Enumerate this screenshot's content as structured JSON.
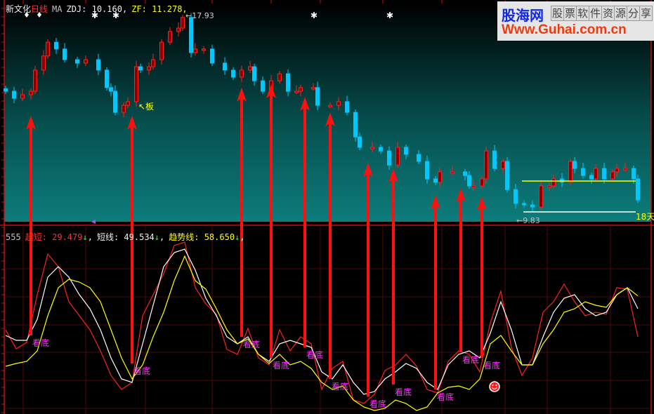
{
  "header": {
    "stock_name": "新文化",
    "period": "日线",
    "ma_label": "MA",
    "zdj": "ZDJ: 10.160,",
    "zf": "ZF: 11.278,"
  },
  "indicator_header": {
    "name": "555",
    "chaoduan": "超短: 29.479",
    "duanxian": "短线: 49.534",
    "qushixian": "趋势线: 58.650",
    "down_arrow": "↓",
    "comma": ","
  },
  "logo": {
    "brand": "股海网",
    "slogan": [
      "股",
      "票",
      "软",
      "件",
      "资",
      "源",
      "分",
      "享"
    ],
    "url": "Www.Guhai.com.cn"
  },
  "annotations": {
    "high_label": "←17.93",
    "low_label": "←9.83",
    "days_label": "18天",
    "board_label": "↖板"
  },
  "colors": {
    "up": "#ff2020",
    "down": "#00c8ff",
    "chaoduan": "#ff2020",
    "duanxian": "#ffffff",
    "qushixian": "#ffff00",
    "signal": "#ff1010",
    "signal_label": "#ff30ff"
  },
  "chart_data": [
    {
      "type": "candlestick",
      "title": "新文化 日线",
      "xlabel": "bar",
      "ylabel": "price",
      "ylim": [
        9.5,
        18.5
      ],
      "high_price": 17.93,
      "low_price": 9.83,
      "range_high_line": 11.05,
      "candles": [
        {
          "b": 0,
          "c": 14.75
        },
        {
          "b": 2,
          "c": 14.46
        },
        {
          "b": 4,
          "c": 14.61
        },
        {
          "b": 6,
          "c": 14.75
        },
        {
          "b": 7,
          "c": 15.62
        },
        {
          "b": 9,
          "c": 16.2
        },
        {
          "b": 10,
          "c": 16.77
        },
        {
          "b": 12,
          "c": 16.49
        },
        {
          "b": 14,
          "c": 16.05
        },
        {
          "b": 17,
          "c": 15.91
        },
        {
          "b": 19,
          "c": 16.05
        },
        {
          "b": 22,
          "c": 15.62
        },
        {
          "b": 24,
          "c": 14.9
        },
        {
          "b": 25,
          "c": 14.75
        },
        {
          "b": 26,
          "c": 13.88
        },
        {
          "b": 28,
          "c": 14.17
        },
        {
          "b": 29,
          "c": 14.32
        },
        {
          "b": 31,
          "c": 15.76
        },
        {
          "b": 32,
          "c": 15.62
        },
        {
          "b": 34,
          "c": 15.76
        },
        {
          "b": 35,
          "c": 16.05
        },
        {
          "b": 37,
          "c": 16.77
        },
        {
          "b": 39,
          "c": 17.21
        },
        {
          "b": 41,
          "c": 17.35
        },
        {
          "b": 42,
          "c": 17.79
        },
        {
          "b": 44,
          "c": 16.34
        },
        {
          "b": 45,
          "c": 16.49
        },
        {
          "b": 47,
          "c": 16.49
        },
        {
          "b": 49,
          "c": 15.91
        },
        {
          "b": 52,
          "c": 15.62
        },
        {
          "b": 54,
          "c": 15.33
        },
        {
          "b": 56,
          "c": 15.62
        },
        {
          "b": 58,
          "c": 15.76
        },
        {
          "b": 59,
          "c": 15.18
        },
        {
          "b": 61,
          "c": 14.75
        },
        {
          "b": 63,
          "c": 15.18
        },
        {
          "b": 65,
          "c": 15.47
        },
        {
          "b": 67,
          "c": 14.75
        },
        {
          "b": 69,
          "c": 14.75
        },
        {
          "b": 70,
          "c": 14.9
        },
        {
          "b": 73,
          "c": 14.9
        },
        {
          "b": 74,
          "c": 14.17
        },
        {
          "b": 77,
          "c": 14.17
        },
        {
          "b": 79,
          "c": 14.32
        },
        {
          "b": 81,
          "c": 13.88
        },
        {
          "b": 83,
          "c": 12.87
        },
        {
          "b": 84,
          "c": 12.44
        },
        {
          "b": 87,
          "c": 12.44
        },
        {
          "b": 89,
          "c": 12.29
        },
        {
          "b": 91,
          "c": 11.71
        },
        {
          "b": 93,
          "c": 12.44
        },
        {
          "b": 95,
          "c": 12.15
        },
        {
          "b": 98,
          "c": 11.86
        },
        {
          "b": 100,
          "c": 11.14
        },
        {
          "b": 102,
          "c": 11.0
        },
        {
          "b": 103,
          "c": 11.43
        },
        {
          "b": 106,
          "c": 11.43
        },
        {
          "b": 109,
          "c": 11.28
        },
        {
          "b": 110,
          "c": 10.85
        },
        {
          "b": 111,
          "c": 10.85
        },
        {
          "b": 113,
          "c": 11.14
        },
        {
          "b": 114,
          "c": 12.29
        },
        {
          "b": 116,
          "c": 11.57
        },
        {
          "b": 118,
          "c": 11.86
        },
        {
          "b": 119,
          "c": 10.7
        },
        {
          "b": 121,
          "c": 10.13
        },
        {
          "b": 123,
          "c": 10.07
        },
        {
          "b": 125,
          "c": 9.98
        },
        {
          "b": 127,
          "c": 10.85
        },
        {
          "b": 129,
          "c": 10.85
        },
        {
          "b": 130,
          "c": 11.14
        },
        {
          "b": 132,
          "c": 11.0
        },
        {
          "b": 134,
          "c": 11.86
        },
        {
          "b": 135,
          "c": 11.57
        },
        {
          "b": 137,
          "c": 11.28
        },
        {
          "b": 139,
          "c": 11.14
        },
        {
          "b": 140,
          "c": 11.57
        },
        {
          "b": 142,
          "c": 11.14
        },
        {
          "b": 144,
          "c": 11.43
        },
        {
          "b": 145,
          "c": 11.57
        },
        {
          "b": 147,
          "c": 11.57
        },
        {
          "b": 149,
          "c": 11.14
        },
        {
          "b": 150,
          "c": 10.27
        }
      ],
      "markers": [
        {
          "b": 5,
          "shape": "diamond"
        },
        {
          "b": 8,
          "shape": "diamond"
        },
        {
          "b": 21,
          "shape": "star"
        },
        {
          "b": 26,
          "shape": "star"
        },
        {
          "b": 73,
          "shape": "star"
        },
        {
          "b": 91,
          "shape": "star"
        }
      ]
    },
    {
      "type": "line",
      "title": "555",
      "xlabel": "bar",
      "ylabel": "value",
      "bar_step": 2.5,
      "ylim": [
        -25,
        100
      ],
      "series": [
        {
          "name": "超短",
          "values": [
            34.5,
            21,
            25.5,
            59.5,
            88.5,
            79.5,
            54.5,
            44.5,
            34.5,
            19.5,
            2,
            -8,
            -3,
            44.5,
            59.5,
            74.5,
            94.5,
            97,
            64.5,
            53,
            45.5,
            20.5,
            17,
            35.5,
            14.5,
            9.5,
            34.5,
            19.5,
            29.5,
            24.5,
            -8,
            7,
            12,
            -15.5,
            -18,
            -11.5,
            5.5,
            9.5,
            17,
            8.5,
            -8,
            -10.5,
            12,
            19.5,
            17,
            4.5,
            39.5,
            62,
            22,
            2,
            14.5,
            47,
            54.5,
            67,
            54.5,
            44.5,
            47,
            45.5,
            64.5,
            63.5,
            29.479
          ]
        },
        {
          "name": "短线",
          "values": [
            30.5,
            27,
            27,
            42,
            72,
            79.5,
            72,
            59.5,
            49.5,
            34.5,
            14.5,
            -0.5,
            -3,
            24.5,
            52,
            79.5,
            89.5,
            92,
            77,
            57,
            44.5,
            29.5,
            24.5,
            29.5,
            17,
            12,
            24.5,
            27,
            24.5,
            22,
            4.5,
            -0.5,
            9.5,
            -3,
            -11.5,
            -9.5,
            -0.5,
            4.5,
            10.5,
            7,
            -3,
            -8,
            9.5,
            17,
            19.5,
            14.5,
            32,
            54.5,
            34.5,
            9.5,
            9.5,
            29.5,
            47,
            57,
            59.5,
            49.5,
            44.5,
            47,
            59.5,
            64.5,
            49.534
          ]
        },
        {
          "name": "趋势线",
          "values": [
            8.5,
            10.5,
            12,
            19.5,
            44.5,
            64.5,
            70.5,
            68.5,
            64.5,
            54.5,
            34.5,
            14.5,
            -0.5,
            9.5,
            29.5,
            47,
            69.5,
            87,
            69.5,
            63.5,
            49.5,
            34.5,
            24.5,
            28,
            17,
            10.5,
            17,
            9.5,
            12,
            7,
            -3,
            -8,
            -5.5,
            -15.5,
            -20.5,
            -23,
            -21.5,
            -15.5,
            -18,
            -23,
            -20.5,
            -10.5,
            -6.5,
            -5.5,
            -8,
            -0.5,
            24.5,
            30.5,
            19.5,
            9.5,
            9.5,
            24.5,
            34.5,
            47,
            49.5,
            54.5,
            52,
            50.5,
            59.5,
            64.5,
            58.65
          ]
        }
      ],
      "signals": [
        {
          "b": 6,
          "price": 13.74,
          "value": 30.5,
          "label": "看底"
        },
        {
          "b": 30,
          "price": 13.74,
          "value": 10.5,
          "label": "看底"
        },
        {
          "b": 56,
          "price": 14.9,
          "value": 29.5,
          "label": "看底"
        },
        {
          "b": 63,
          "price": 15.04,
          "value": 14.5,
          "label": "看底"
        },
        {
          "b": 71,
          "price": 14.52,
          "value": 22,
          "label": "看底"
        },
        {
          "b": 77,
          "price": 13.88,
          "value": -0.5,
          "label": "看底"
        },
        {
          "b": 86,
          "price": 11.8,
          "value": -13,
          "label": "看底"
        },
        {
          "b": 92,
          "price": 11.57,
          "value": -4.5,
          "label": "看底"
        },
        {
          "b": 102,
          "price": 10.47,
          "value": -8,
          "label": "看底"
        },
        {
          "b": 108,
          "price": 10.76,
          "value": 18.5,
          "label": "看底"
        },
        {
          "b": 113,
          "price": 10.41,
          "value": 14.5,
          "label": "看底"
        }
      ],
      "smiley_bar": 116,
      "smiley_value": -6
    }
  ]
}
